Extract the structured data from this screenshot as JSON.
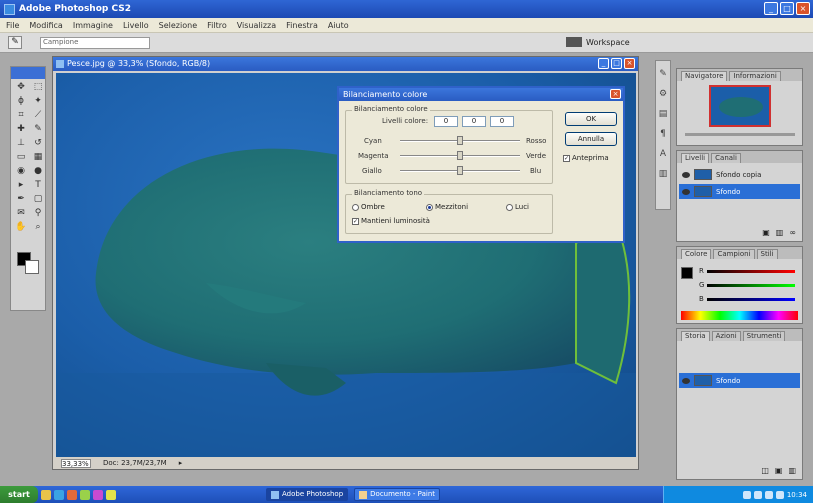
{
  "app": {
    "title": "Adobe Photoshop CS2"
  },
  "menu": [
    "File",
    "Modifica",
    "Immagine",
    "Livello",
    "Selezione",
    "Filtro",
    "Visualizza",
    "Finestra",
    "Aiuto"
  ],
  "options": {
    "input_value": "Campione"
  },
  "workspace": {
    "label": "Workspace"
  },
  "document": {
    "title": "Pesce.jpg @ 33,3% (Sfondo, RGB/8)",
    "zoom": "33,33%",
    "doc_info": "Doc: 23,7M/23,7M"
  },
  "dialog": {
    "title": "Bilanciamento colore",
    "group1_title": "Bilanciamento colore",
    "levels_label": "Livelli colore:",
    "levels": [
      "0",
      "0",
      "0"
    ],
    "sliders": [
      {
        "left": "Cyan",
        "right": "Rosso",
        "value": 0
      },
      {
        "left": "Magenta",
        "right": "Verde",
        "value": 0
      },
      {
        "left": "Giallo",
        "right": "Blu",
        "value": 0
      }
    ],
    "group2_title": "Bilanciamento tono",
    "tones": [
      "Ombre",
      "Mezzitoni",
      "Luci"
    ],
    "selected_tone": "Mezzitoni",
    "preserve_label": "Mantieni luminosità",
    "ok": "OK",
    "cancel": "Annulla",
    "preview_label": "Anteprima"
  },
  "panels": {
    "navigator_tabs": [
      "Navigatore",
      "Informazioni"
    ],
    "layers_tabs": [
      "Livelli",
      "Canali"
    ],
    "layers": [
      {
        "name": "Sfondo copia",
        "selected": false
      },
      {
        "name": "Sfondo",
        "selected": true
      }
    ],
    "color_tabs": [
      "Colore",
      "Campioni",
      "Stili"
    ],
    "color_channels": [
      "R",
      "G",
      "B"
    ],
    "history_tabs": [
      "Storia",
      "Azioni",
      "Strumenti"
    ],
    "history_item": "Sfondo"
  },
  "taskbar": {
    "start": "start",
    "tasks": [
      "Adobe Photoshop",
      "Documento - Paint"
    ],
    "clock": "10:34"
  },
  "colors": {
    "accent": "#2a6fd6",
    "water": "#1b5ea9",
    "fish": "#1f6e74"
  }
}
